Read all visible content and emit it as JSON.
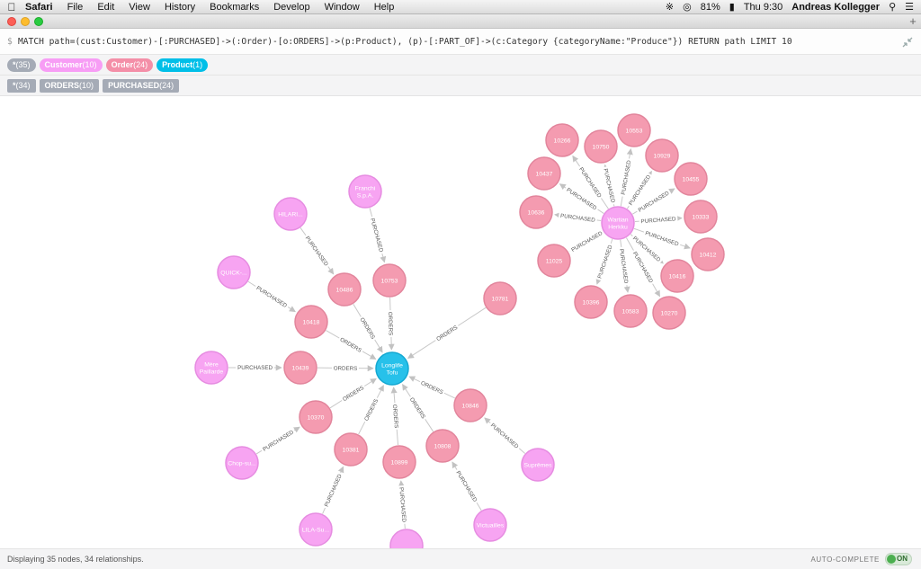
{
  "menubar": {
    "app": "Safari",
    "items": [
      "File",
      "Edit",
      "View",
      "History",
      "Bookmarks",
      "Develop",
      "Window",
      "Help"
    ],
    "battery": "81%",
    "clock": "Thu 9:30",
    "user": "Andreas Kollegger"
  },
  "editor": {
    "prompt": "$",
    "query": "MATCH path=(cust:Customer)-[:PURCHASED]->(:Order)-[o:ORDERS]->(p:Product), (p)-[:PART_OF]->(c:Category {categoryName:\"Produce\"}) RETURN path LIMIT 10"
  },
  "labels": [
    {
      "name": "*",
      "count": "(35)",
      "color": "#a5abb6"
    },
    {
      "name": "Customer",
      "count": "(10)",
      "color": "#f79df5"
    },
    {
      "name": "Order",
      "count": "(24)",
      "color": "#f48fa8"
    },
    {
      "name": "Product",
      "count": "(1)",
      "color": "#00bfe8"
    }
  ],
  "relationships": [
    {
      "name": "*",
      "count": "(34)"
    },
    {
      "name": "ORDERS",
      "count": "(10)"
    },
    {
      "name": "PURCHASED",
      "count": "(24)"
    }
  ],
  "colors": {
    "customer": "#f7a4f2",
    "customer_stroke": "#e68ce1",
    "order": "#f49bb0",
    "order_stroke": "#e2859c",
    "product": "#27c1ea",
    "product_stroke": "#14a8d2",
    "edge": "#c8c8c8"
  },
  "graph": {
    "nodes": [
      {
        "id": "p",
        "type": "product",
        "label": "Longlife Tofu"
      },
      {
        "id": "c_hilari",
        "type": "customer",
        "label": "HILARI..."
      },
      {
        "id": "c_franchi",
        "type": "customer",
        "label": "Franchi S.p.A."
      },
      {
        "id": "c_quick",
        "type": "customer",
        "label": "QUICK-..."
      },
      {
        "id": "c_mere",
        "type": "customer",
        "label": "Mère Paillarde"
      },
      {
        "id": "c_chop",
        "type": "customer",
        "label": "Chop-su..."
      },
      {
        "id": "c_lila",
        "type": "customer",
        "label": "LILA-Su..."
      },
      {
        "id": "c_bottom",
        "type": "customer",
        "label": ""
      },
      {
        "id": "c_victuailles",
        "type": "customer",
        "label": "Victuailles"
      },
      {
        "id": "c_supremes",
        "type": "customer",
        "label": "Suprêmes"
      },
      {
        "id": "c_wartian",
        "type": "customer",
        "label": "Wartian Herkku"
      },
      {
        "id": "o10486",
        "type": "order",
        "label": "10486"
      },
      {
        "id": "o10753",
        "type": "order",
        "label": "10753"
      },
      {
        "id": "o10418",
        "type": "order",
        "label": "10418"
      },
      {
        "id": "o10439",
        "type": "order",
        "label": "10439"
      },
      {
        "id": "o10370",
        "type": "order",
        "label": "10370"
      },
      {
        "id": "o10381",
        "type": "order",
        "label": "10381"
      },
      {
        "id": "o10899",
        "type": "order",
        "label": "10899"
      },
      {
        "id": "o10808",
        "type": "order",
        "label": "10808"
      },
      {
        "id": "o10846",
        "type": "order",
        "label": "10846"
      },
      {
        "id": "o10781",
        "type": "order",
        "label": "10781"
      },
      {
        "id": "o11025",
        "type": "order",
        "label": "11025"
      },
      {
        "id": "o10266",
        "type": "order",
        "label": "10266"
      },
      {
        "id": "o10750",
        "type": "order",
        "label": "10750"
      },
      {
        "id": "o10553",
        "type": "order",
        "label": "10553"
      },
      {
        "id": "o10929",
        "type": "order",
        "label": "10929"
      },
      {
        "id": "o10455",
        "type": "order",
        "label": "10455"
      },
      {
        "id": "o10333",
        "type": "order",
        "label": "10333"
      },
      {
        "id": "o10437",
        "type": "order",
        "label": "10437"
      },
      {
        "id": "o10636",
        "type": "order",
        "label": "10636"
      },
      {
        "id": "o10412",
        "type": "order",
        "label": "10412"
      },
      {
        "id": "o10416",
        "type": "order",
        "label": "10416"
      },
      {
        "id": "o10396",
        "type": "order",
        "label": "10396"
      },
      {
        "id": "o10583",
        "type": "order",
        "label": "10583"
      },
      {
        "id": "o10270",
        "type": "order",
        "label": "10270"
      }
    ],
    "edges": [
      {
        "from": "c_hilari",
        "to": "o10486",
        "label": "PURCHASED"
      },
      {
        "from": "c_franchi",
        "to": "o10753",
        "label": "PURCHASED"
      },
      {
        "from": "c_quick",
        "to": "o10418",
        "label": "PURCHASED"
      },
      {
        "from": "c_mere",
        "to": "o10439",
        "label": "PURCHASED"
      },
      {
        "from": "c_chop",
        "to": "o10370",
        "label": "PURCHASED"
      },
      {
        "from": "c_lila",
        "to": "o10381",
        "label": "PURCHASED"
      },
      {
        "from": "c_bottom",
        "to": "o10899",
        "label": "PURCHASED"
      },
      {
        "from": "c_victuailles",
        "to": "o10808",
        "label": "PURCHASED"
      },
      {
        "from": "c_supremes",
        "to": "o10846",
        "label": "PURCHASED"
      },
      {
        "from": "o10486",
        "to": "p",
        "label": "ORDERS"
      },
      {
        "from": "o10753",
        "to": "p",
        "label": "ORDERS"
      },
      {
        "from": "o10418",
        "to": "p",
        "label": "ORDERS"
      },
      {
        "from": "o10439",
        "to": "p",
        "label": "ORDERS"
      },
      {
        "from": "o10370",
        "to": "p",
        "label": "ORDERS"
      },
      {
        "from": "o10381",
        "to": "p",
        "label": "ORDERS"
      },
      {
        "from": "o10899",
        "to": "p",
        "label": "ORDERS"
      },
      {
        "from": "o10808",
        "to": "p",
        "label": "ORDERS"
      },
      {
        "from": "o10846",
        "to": "p",
        "label": "ORDERS"
      },
      {
        "from": "o10781",
        "to": "p",
        "label": "ORDERS"
      },
      {
        "from": "c_wartian",
        "to": "o10266",
        "label": "PURCHASED"
      },
      {
        "from": "c_wartian",
        "to": "o10750",
        "label": "PURCHASED"
      },
      {
        "from": "c_wartian",
        "to": "o10553",
        "label": "PURCHASED"
      },
      {
        "from": "c_wartian",
        "to": "o10929",
        "label": "PURCHASED"
      },
      {
        "from": "c_wartian",
        "to": "o10455",
        "label": "PURCHASED"
      },
      {
        "from": "c_wartian",
        "to": "o10333",
        "label": "PURCHASED"
      },
      {
        "from": "c_wartian",
        "to": "o10437",
        "label": "PURCHASED"
      },
      {
        "from": "c_wartian",
        "to": "o10636",
        "label": "PURCHASED"
      },
      {
        "from": "c_wartian",
        "to": "o10412",
        "label": "PURCHASED"
      },
      {
        "from": "c_wartian",
        "to": "o10416",
        "label": "PURCHASED"
      },
      {
        "from": "c_wartian",
        "to": "o10396",
        "label": "PURCHASED"
      },
      {
        "from": "c_wartian",
        "to": "o10583",
        "label": "PURCHASED"
      },
      {
        "from": "c_wartian",
        "to": "o10270",
        "label": "PURCHASED"
      },
      {
        "from": "c_wartian",
        "to": "o11025",
        "label": "PURCHASED"
      }
    ]
  },
  "footer": {
    "status": "Displaying 35 nodes, 34 relationships.",
    "autocomplete_label": "AUTO-COMPLETE",
    "toggle_state": "ON"
  }
}
